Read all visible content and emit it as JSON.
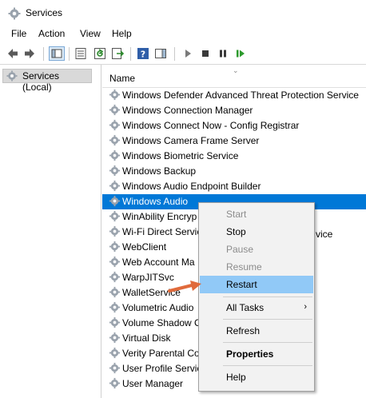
{
  "window": {
    "title": "Services"
  },
  "menu": [
    "File",
    "Action",
    "View",
    "Help"
  ],
  "tree": {
    "selected_label": "Services (Local)"
  },
  "list": {
    "column_header": "Name",
    "rows": [
      "Windows Defender Advanced Threat Protection Service",
      "Windows Connection Manager",
      "Windows Connect Now - Config Registrar",
      "Windows Camera Frame Server",
      "Windows Biometric Service",
      "Windows Backup",
      "Windows Audio Endpoint Builder",
      "Windows Audio",
      "WinAbility Encryp",
      "Wi-Fi Direct Servic",
      "WebClient",
      "Web Account Ma",
      "WarpJITSvc",
      "WalletService",
      "Volumetric Audio",
      "Volume Shadow C",
      "Virtual Disk",
      "Verity Parental Co",
      "User Profile Servic",
      "User Manager"
    ],
    "partial_suffix": "vice",
    "selected_index": 7
  },
  "context_menu": {
    "start": "Start",
    "stop": "Stop",
    "pause": "Pause",
    "resume": "Resume",
    "restart": "Restart",
    "all_tasks": "All Tasks",
    "all_tasks_arrow": "›",
    "refresh": "Refresh",
    "properties": "Properties",
    "help": "Help"
  },
  "colors": {
    "selection": "#0078d7",
    "menu_highlight": "#91c9f7",
    "arrow": "#e06a3b"
  }
}
